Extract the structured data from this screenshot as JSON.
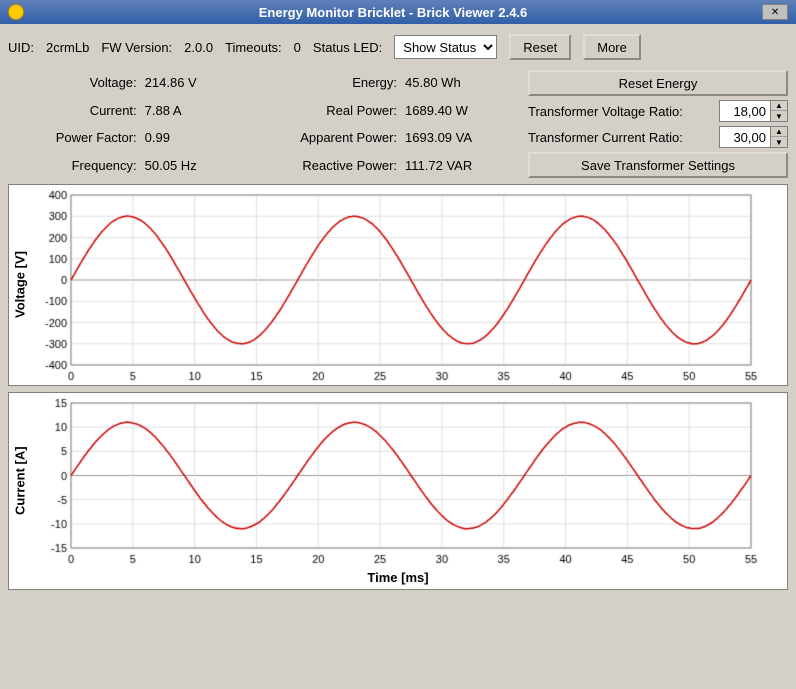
{
  "window": {
    "title": "Energy Monitor Bricklet - Brick Viewer 2.4.6"
  },
  "topbar": {
    "uid_label": "UID:",
    "uid_value": "2crmLb",
    "fw_label": "FW Version:",
    "fw_value": "2.0.0",
    "timeouts_label": "Timeouts:",
    "timeouts_value": "0",
    "status_led_label": "Status LED:",
    "status_led_option": "Show Status",
    "reset_label": "Reset",
    "more_label": "More"
  },
  "info": {
    "voltage_label": "Voltage:",
    "voltage_value": "214.86 V",
    "energy_label": "Energy:",
    "energy_value": "45.80 Wh",
    "current_label": "Current:",
    "current_value": "7.88 A",
    "real_power_label": "Real Power:",
    "real_power_value": "1689.40 W",
    "power_factor_label": "Power Factor:",
    "power_factor_value": "0.99",
    "apparent_power_label": "Apparent Power:",
    "apparent_power_value": "1693.09 VA",
    "frequency_label": "Frequency:",
    "frequency_value": "50.05 Hz",
    "reactive_power_label": "Reactive Power:",
    "reactive_power_value": "111.72 VAR"
  },
  "controls": {
    "reset_energy_label": "Reset Energy",
    "transformer_voltage_label": "Transformer Voltage Ratio:",
    "transformer_voltage_value": "18,00",
    "transformer_current_label": "Transformer Current Ratio:",
    "transformer_current_value": "30,00",
    "save_transformer_label": "Save Transformer Settings"
  },
  "voltage_chart": {
    "y_label": "Voltage [V]",
    "y_max": 400,
    "y_min": -400,
    "y_ticks": [
      400,
      300,
      200,
      100,
      0,
      -100,
      -200,
      -300,
      -400
    ]
  },
  "current_chart": {
    "y_label": "Current [A]",
    "y_max": 15,
    "y_min": -15,
    "y_ticks": [
      15,
      10,
      5,
      0,
      -5,
      -10,
      -15
    ]
  },
  "x_axis": {
    "label": "Time [ms]",
    "ticks": [
      0,
      5,
      10,
      15,
      20,
      25,
      30,
      35,
      40,
      45,
      50,
      55
    ]
  },
  "colors": {
    "wave": "#cc0000",
    "grid": "#e0e0e0",
    "background": "#ffffff"
  }
}
